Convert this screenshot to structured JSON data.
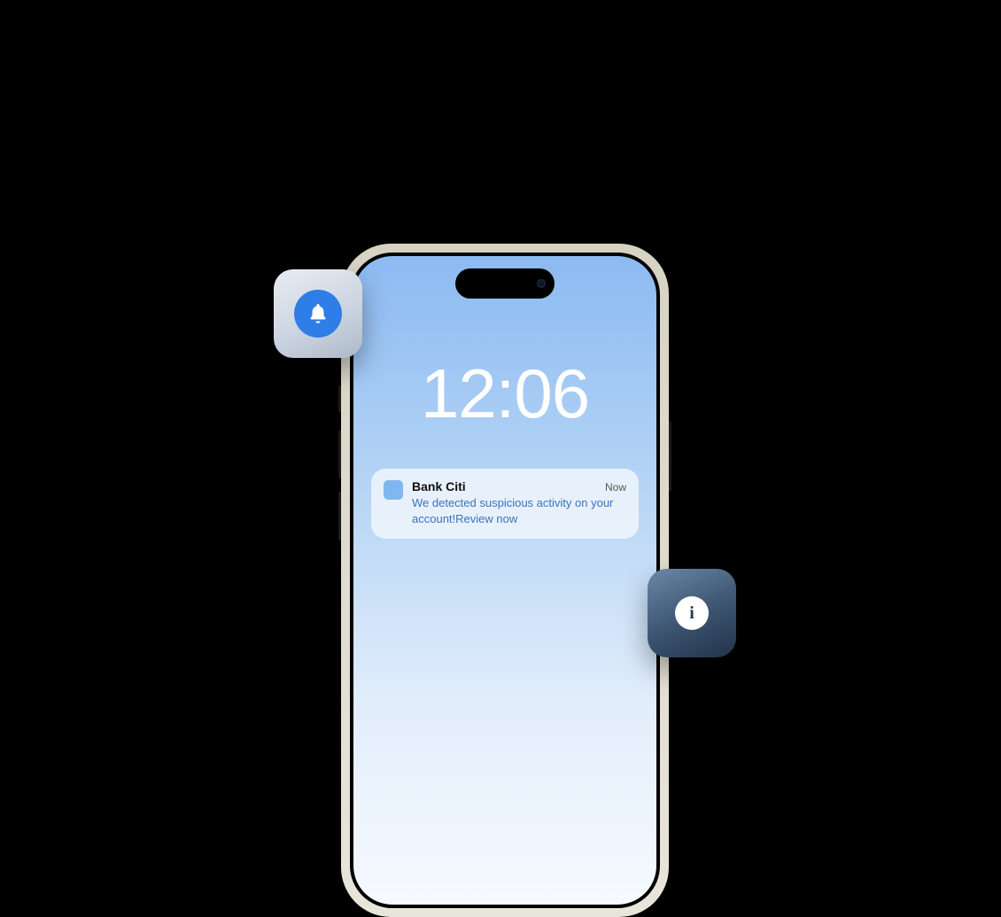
{
  "lockscreen": {
    "time": "12:06"
  },
  "notification": {
    "app_name": "Bank Citi",
    "timestamp": "Now",
    "message": "We detected suspicious activity on your account!Review now"
  },
  "icons": {
    "bell": "bell-icon",
    "info_glyph": "i"
  },
  "colors": {
    "accent": "#2f7de6",
    "notif_link": "#3b72bf"
  }
}
